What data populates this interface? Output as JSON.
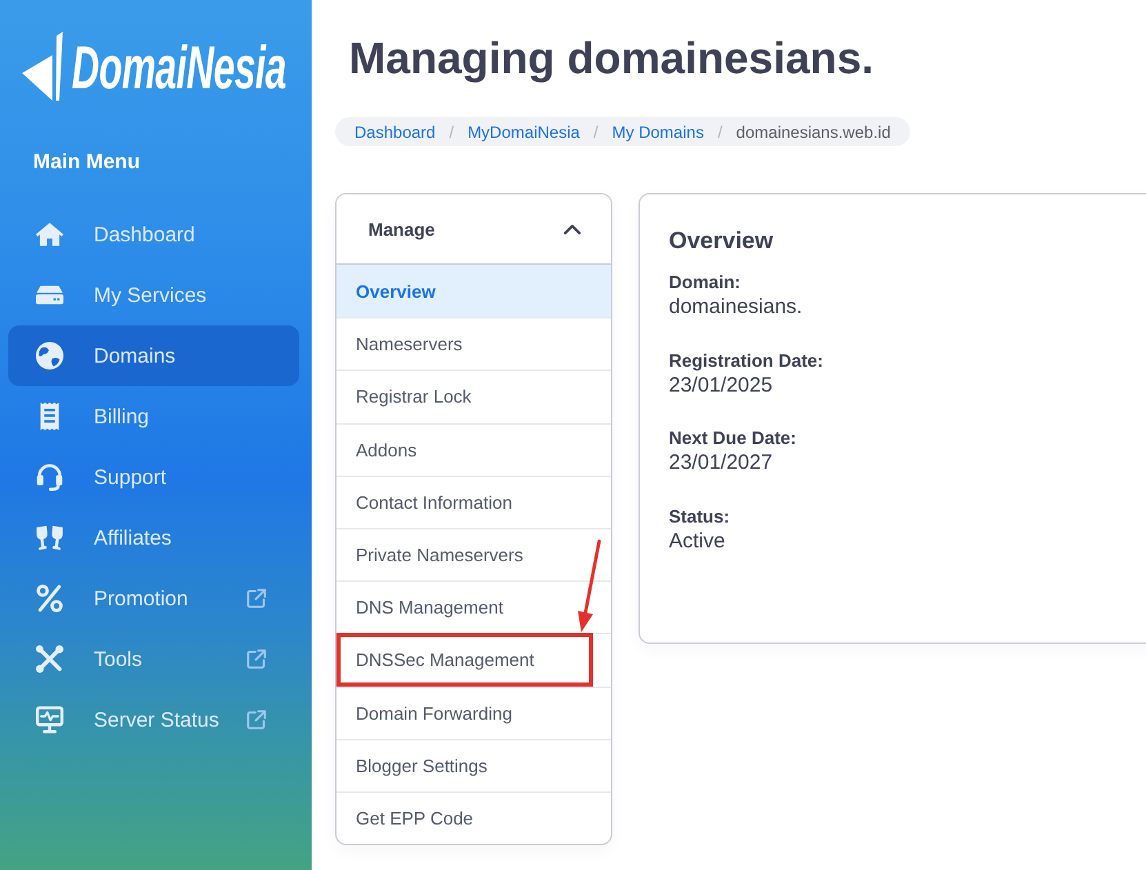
{
  "sidebar": {
    "logo": "DomaiNesia",
    "heading": "Main Menu",
    "items": [
      {
        "label": "Dashboard",
        "selected": false,
        "external": false
      },
      {
        "label": "My Services",
        "selected": false,
        "external": false
      },
      {
        "label": "Domains",
        "selected": true,
        "external": false
      },
      {
        "label": "Billing",
        "selected": false,
        "external": false
      },
      {
        "label": "Support",
        "selected": false,
        "external": false
      },
      {
        "label": "Affiliates",
        "selected": false,
        "external": false
      },
      {
        "label": "Promotion",
        "selected": false,
        "external": true
      },
      {
        "label": "Tools",
        "selected": false,
        "external": true
      },
      {
        "label": "Server Status",
        "selected": false,
        "external": true
      }
    ]
  },
  "page": {
    "title": "Managing domainesians.",
    "breadcrumb": [
      {
        "kind": "link",
        "label": "Dashboard"
      },
      {
        "kind": "separator",
        "label": "/"
      },
      {
        "kind": "link",
        "label": "MyDomaiNesia"
      },
      {
        "kind": "separator",
        "label": "/"
      },
      {
        "kind": "link",
        "label": "My Domains"
      },
      {
        "kind": "separator",
        "label": "/"
      },
      {
        "kind": "current",
        "label": "domainesians.web.id"
      }
    ]
  },
  "manage": {
    "title": "Manage",
    "expanded": true,
    "items": [
      {
        "label": "Overview",
        "selected": true,
        "highlighted": false
      },
      {
        "label": "Nameservers",
        "selected": false,
        "highlighted": false
      },
      {
        "label": "Registrar Lock",
        "selected": false,
        "highlighted": false
      },
      {
        "label": "Addons",
        "selected": false,
        "highlighted": false
      },
      {
        "label": "Contact Information",
        "selected": false,
        "highlighted": false
      },
      {
        "label": "Private Nameservers",
        "selected": false,
        "highlighted": false
      },
      {
        "label": "DNS Management",
        "selected": false,
        "highlighted": false
      },
      {
        "label": "DNSSec Management",
        "selected": false,
        "highlighted": true
      },
      {
        "label": "Domain Forwarding",
        "selected": false,
        "highlighted": false
      },
      {
        "label": "Blogger Settings",
        "selected": false,
        "highlighted": false
      },
      {
        "label": "Get EPP Code",
        "selected": false,
        "highlighted": false
      }
    ]
  },
  "overview": {
    "title": "Overview",
    "fields": [
      {
        "label": "Domain:",
        "value": "domainesians."
      },
      {
        "label": "Registration Date:",
        "value": "23/01/2025"
      },
      {
        "label": "Next Due Date:",
        "value": "23/01/2027"
      },
      {
        "label": "Status:",
        "value": "Active"
      }
    ]
  }
}
